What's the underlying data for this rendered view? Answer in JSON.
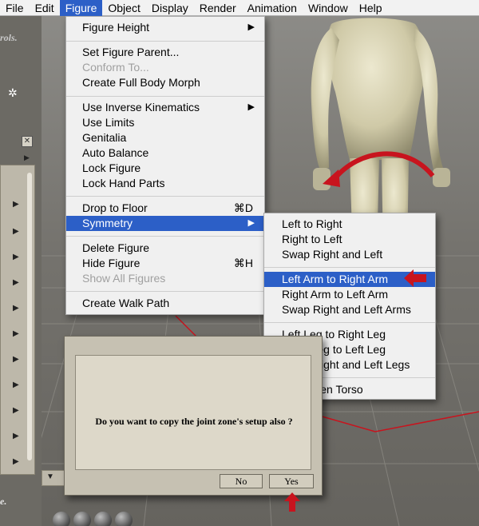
{
  "menubar": {
    "items": [
      "File",
      "Edit",
      "Figure",
      "Object",
      "Display",
      "Render",
      "Animation",
      "Window",
      "Help"
    ],
    "active": "Figure"
  },
  "figure_menu": {
    "items": [
      {
        "label": "Figure Height",
        "submenu": true
      },
      {
        "label": "Set Figure Parent...",
        "disabled": false
      },
      {
        "label": "Conform To...",
        "disabled": true
      },
      {
        "label": "Create Full Body Morph",
        "disabled": false
      },
      {
        "label": "Use Inverse Kinematics",
        "submenu": true
      },
      {
        "label": "Use Limits"
      },
      {
        "label": "Genitalia"
      },
      {
        "label": "Auto Balance"
      },
      {
        "label": "Lock Figure"
      },
      {
        "label": "Lock Hand Parts"
      },
      {
        "label": "Drop to Floor",
        "shortcut": "⌘D"
      },
      {
        "label": "Symmetry",
        "submenu": true,
        "highlighted": true
      },
      {
        "label": "Delete Figure"
      },
      {
        "label": "Hide  Figure",
        "shortcut": "⌘H"
      },
      {
        "label": "Show All Figures",
        "disabled": true
      },
      {
        "label": "Create Walk Path"
      }
    ]
  },
  "symmetry_submenu": {
    "items": [
      {
        "label": "Left to Right"
      },
      {
        "label": "Right to Left"
      },
      {
        "label": "Swap Right and Left"
      },
      {
        "label": "Left Arm to Right Arm",
        "highlighted": true
      },
      {
        "label": "Right Arm to Left Arm"
      },
      {
        "label": "Swap Right and Left Arms"
      },
      {
        "label": "Left Leg to Right Leg"
      },
      {
        "label": "Right Leg to Left Leg"
      },
      {
        "label": "Swap Right and Left Legs"
      },
      {
        "label": "Straighten Torso"
      }
    ]
  },
  "dialog": {
    "message": "Do you want to copy the joint zone's setup also ?",
    "no_label": "No",
    "yes_label": "Yes"
  },
  "background": {
    "fragment_top": "rols.",
    "fragment_bottom": "e."
  },
  "icons": {
    "submenu": "triangle-right-icon",
    "close": "close-icon",
    "gear": "gear-icon",
    "annotation": "red-arrow-icon"
  },
  "colors": {
    "menu_highlight": "#2c5fc7",
    "annotation_red": "#c8141e",
    "dialog_bg": "#c6c1b2"
  }
}
